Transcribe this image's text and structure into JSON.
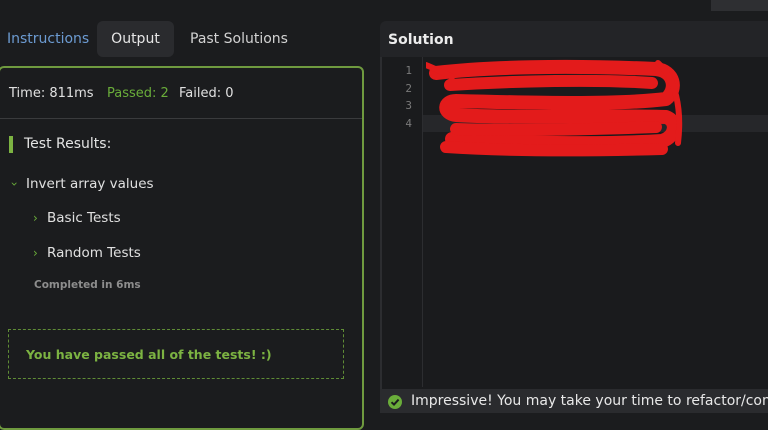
{
  "tabs": {
    "instructions": "Instructions",
    "output": "Output",
    "past_solutions": "Past Solutions"
  },
  "stats": {
    "time": "Time: 811ms",
    "passed": "Passed: 2",
    "failed": "Failed: 0"
  },
  "results": {
    "title": "Test Results:",
    "suite": "Invert array values",
    "groups": [
      "Basic Tests",
      "Random Tests"
    ],
    "completed": "Completed in 6ms",
    "pass_message": "You have passed all of the tests! :)"
  },
  "solution": {
    "title": "Solution",
    "line_numbers": [
      "1",
      "2",
      "3",
      "4"
    ],
    "redaction_color": "#e31b1b"
  },
  "notification": {
    "text": "Impressive! You may take your time to refactor/comme",
    "icon": "check-circle-icon"
  },
  "colors": {
    "accent_green": "#6aad3a",
    "link_blue": "#6c9bd2",
    "panel_border": "#6f9a3f"
  }
}
